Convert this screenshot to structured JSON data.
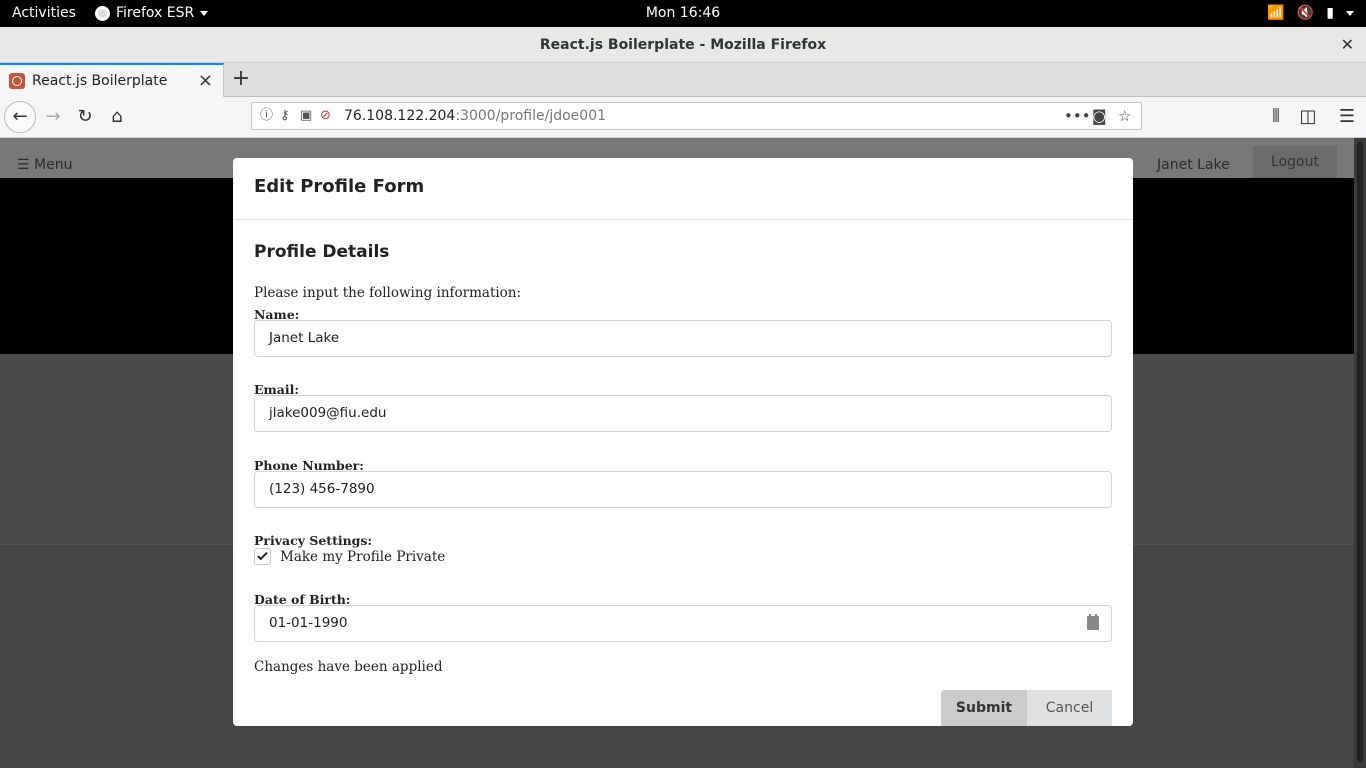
{
  "system_bar": {
    "activities": "Activities",
    "app_name": "Firefox ESR",
    "clock": "Mon 16:46"
  },
  "browser": {
    "window_title": "React.js Boilerplate - Mozilla Firefox",
    "tab_title": "React.js Boilerplate",
    "url_host": "76.108.122.204",
    "url_path": ":3000/profile/jdoe001"
  },
  "app": {
    "menu_label": "Menu",
    "user_name": "Janet Lake",
    "logout_label": "Logout"
  },
  "modal": {
    "title": "Edit Profile Form",
    "section_title": "Profile Details",
    "intro": "Please input the following information:",
    "name_label": "Name:",
    "name_value": "Janet Lake",
    "email_label": "Email:",
    "email_value": "jlake009@fiu.edu",
    "phone_label": "Phone Number:",
    "phone_value": "(123) 456-7890",
    "privacy_label": "Privacy Settings:",
    "privacy_checkbox_label": "Make my Profile Private",
    "privacy_checked": true,
    "dob_label": "Date of Birth:",
    "dob_value": "01-01-1990",
    "status_message": "Changes have been applied",
    "submit_label": "Submit",
    "cancel_label": "Cancel"
  }
}
